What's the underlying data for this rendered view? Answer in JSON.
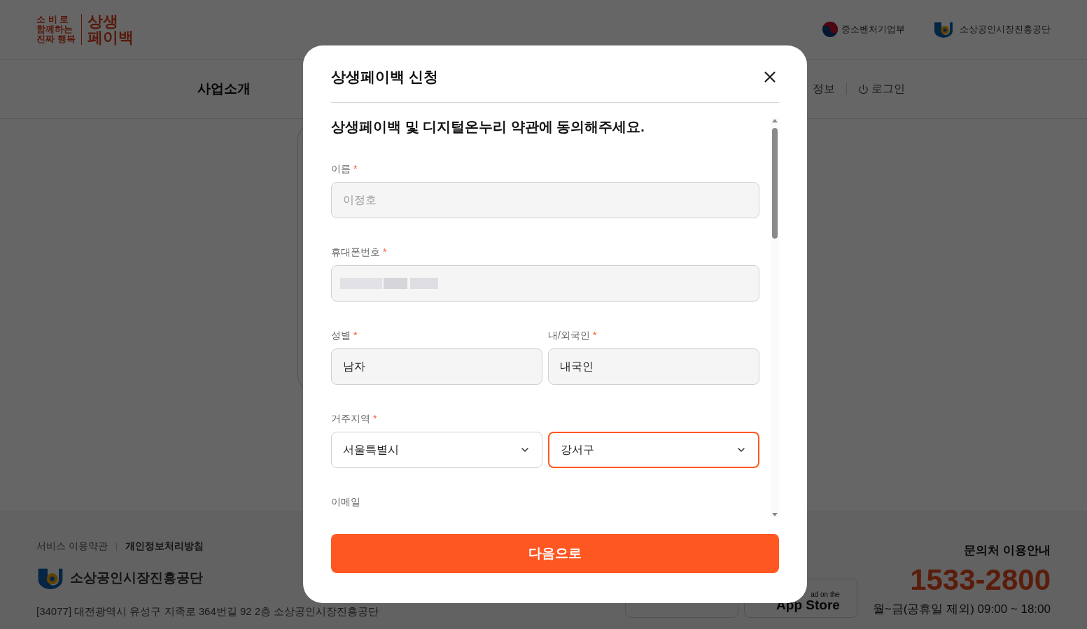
{
  "header": {
    "logo_slogan": [
      "소 비 로",
      "함께하는",
      "진짜 행복"
    ],
    "logo_brand": [
      "상생",
      "페이백"
    ],
    "partners": [
      "중소벤처기업부",
      "소상공인시장진흥공단"
    ]
  },
  "nav": {
    "items": [
      {
        "label": "사업소개",
        "selected": false
      },
      {
        "label": "정보",
        "selected": false
      }
    ],
    "login": "로그인"
  },
  "footer": {
    "links": [
      {
        "label": "서비스 이용약관",
        "bold": false
      },
      {
        "label": "개인정보처리방침",
        "bold": true
      }
    ],
    "org": "소상공인시장진흥공단",
    "address": "[34077] 대전광역시 유성구 지족로 364번길 92 2층 소상공인시장진흥공단",
    "app_store": {
      "small": "ad on the",
      "large": "App Store"
    },
    "contact_title": "문의처 이용안내",
    "phone": "1533-2800",
    "hours": "월~금(공휴일 제외) 09:00 ~ 18:00"
  },
  "modal": {
    "title": "상생페이백 신청",
    "intro": "상생페이백 및 디지털온누리 약관에 동의해주세요.",
    "rows": [
      {
        "fields": [
          {
            "label": "이름",
            "required_mark": "*",
            "kind": "text",
            "value": "이정호",
            "disabled": true
          }
        ]
      },
      {
        "fields": [
          {
            "label": "휴대폰번호",
            "required_mark": "*",
            "kind": "redacted"
          }
        ]
      },
      {
        "fields": [
          {
            "label": "성별",
            "required_mark": "*",
            "kind": "text",
            "value": "남자",
            "disabled": false
          },
          {
            "label": "내/외국인",
            "required_mark": "*",
            "kind": "text",
            "value": "내국인",
            "disabled": false
          }
        ]
      },
      {
        "label": "거주지역",
        "required_mark": "*",
        "fields": [
          {
            "kind": "select",
            "value": "서울특별시",
            "focused": false
          },
          {
            "kind": "select",
            "value": "강서구",
            "focused": true
          }
        ]
      },
      {
        "fields": [
          {
            "label": "이메일",
            "kind": "none"
          }
        ]
      }
    ],
    "next_button": "다음으로"
  }
}
